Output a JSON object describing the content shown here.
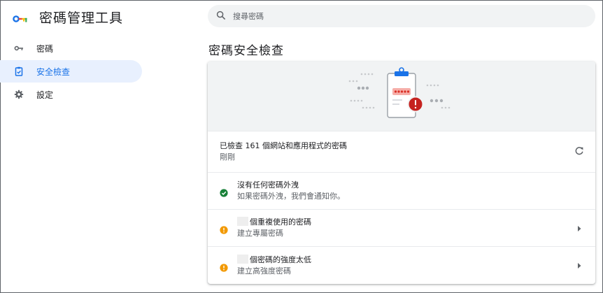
{
  "app": {
    "title": "密碼管理工具"
  },
  "search": {
    "placeholder": "搜尋密碼"
  },
  "sidebar": {
    "items": [
      {
        "label": "密碼",
        "icon": "key-icon",
        "active": false
      },
      {
        "label": "安全檢查",
        "icon": "shield-check-icon",
        "active": true
      },
      {
        "label": "設定",
        "icon": "gear-icon",
        "active": false
      }
    ]
  },
  "main": {
    "title": "密碼安全檢查",
    "checked": {
      "primary": "已檢查 161 個網站和應用程式的密碼",
      "secondary": "剛剛"
    },
    "leaked": {
      "primary": "沒有任何密碼外洩",
      "secondary": "如果密碼外洩，我們會通知你。"
    },
    "reused": {
      "primary": "個重複使用的密碼",
      "secondary": "建立專屬密碼"
    },
    "weak": {
      "primary": "個密碼的強度太低",
      "secondary": "建立高強度密碼"
    }
  },
  "colors": {
    "accent": "#1a73e8",
    "active_bg": "#e8f0fe",
    "success": "#188038",
    "warning": "#f29900",
    "error": "#c5221f"
  }
}
